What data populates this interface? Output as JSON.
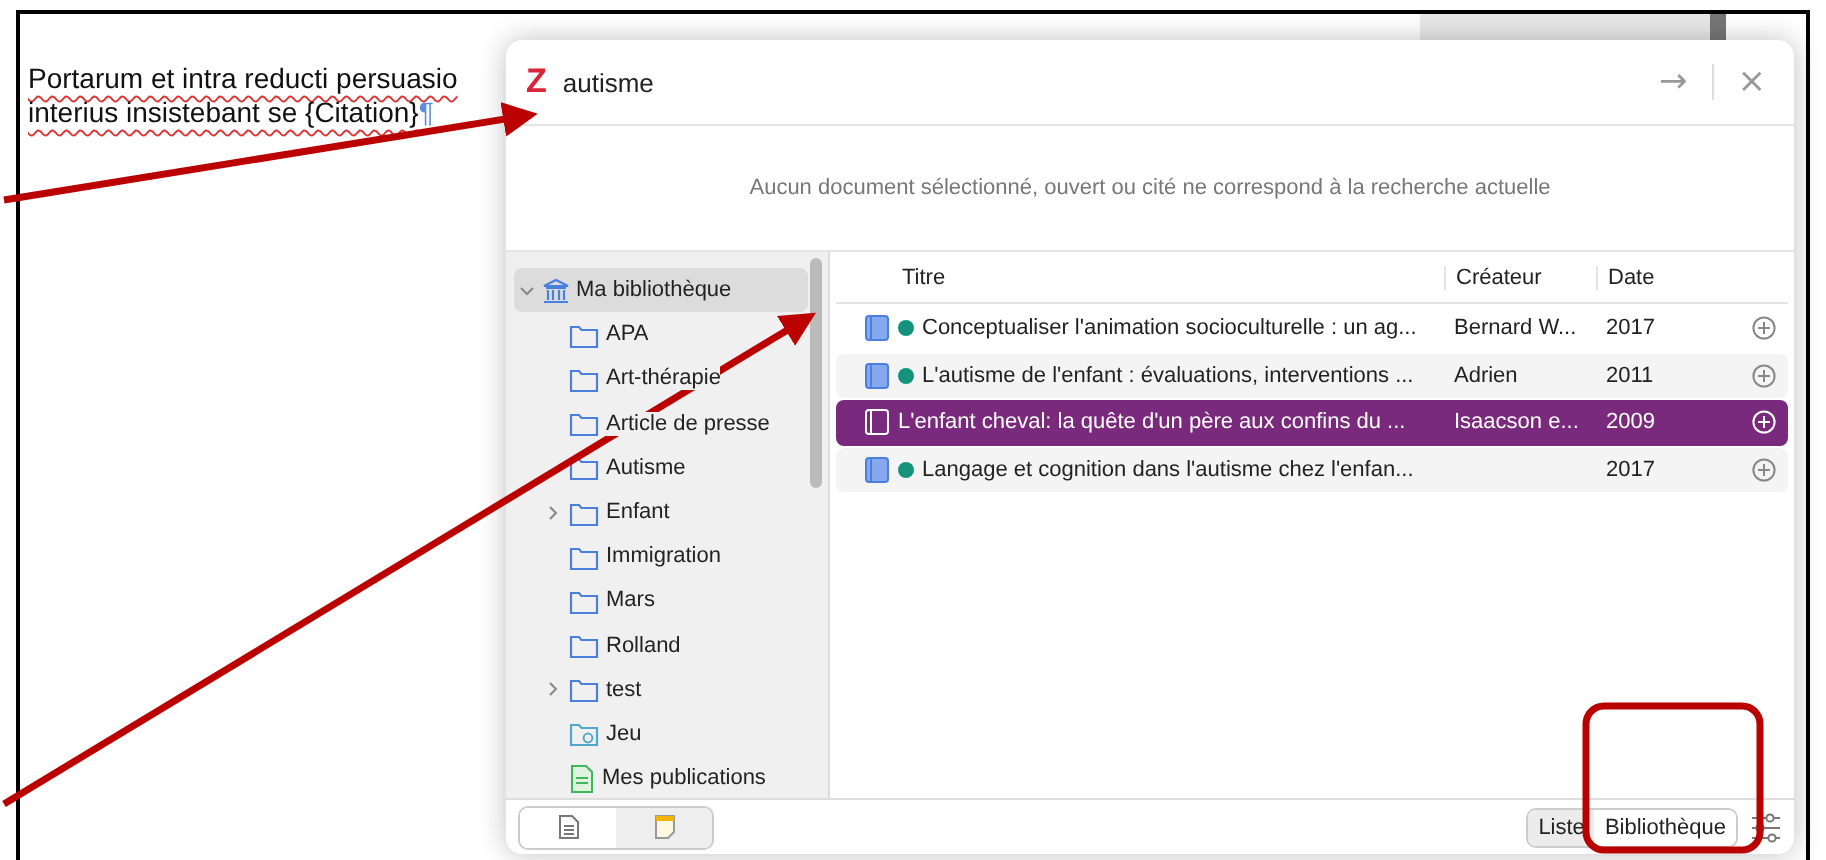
{
  "document": {
    "lines": [
      "Portarum et intra reducti persuasio",
      "interius insistebant se {Citation}"
    ],
    "paragraph_mark": "¶"
  },
  "dialog": {
    "logo": "Z",
    "search": {
      "value": "autisme"
    },
    "go": "→",
    "close": "×",
    "message": "Aucun document sélectionné, ouvert ou cité ne correspond à la recherche actuelle",
    "sidebar": {
      "items": [
        {
          "label": "Ma bibliothèque",
          "kind": "library",
          "selected": true,
          "expanded": true,
          "children": [
            {
              "label": "APA",
              "kind": "collection",
              "selected": false
            },
            {
              "label": "Art-thérapie",
              "kind": "collection",
              "selected": false
            },
            {
              "label": "Article de presse",
              "kind": "collection",
              "selected": false
            },
            {
              "label": "Autisme",
              "kind": "collection",
              "selected": false
            },
            {
              "label": "Enfant",
              "kind": "collection",
              "selected": false,
              "expanded": false
            },
            {
              "label": "Immigration",
              "kind": "collection",
              "selected": false
            },
            {
              "label": "Mars",
              "kind": "collection",
              "selected": false
            },
            {
              "label": "Rolland",
              "kind": "collection",
              "selected": false
            },
            {
              "label": "test",
              "kind": "collection",
              "selected": false,
              "expanded": false
            },
            {
              "label": "Jeu",
              "kind": "search",
              "selected": false
            },
            {
              "label": "Mes publications",
              "kind": "publications",
              "selected": false
            }
          ]
        }
      ]
    },
    "table": {
      "columns": [
        "Titre",
        "Créateur",
        "Date"
      ],
      "rows": [
        {
          "title": "Conceptualiser l'animation socioculturelle : un ag...",
          "creator": "Bernard W...",
          "date": "2017",
          "color": "#12937a",
          "selected": false
        },
        {
          "title": "L'autisme de l'enfant : évaluations, interventions ...",
          "creator": "Adrien",
          "date": "2011",
          "color": "#12937a",
          "selected": false
        },
        {
          "title": "L'enfant cheval: la quête d'un père aux confins du ...",
          "creator": "Isaacson e...",
          "date": "2009",
          "selected": true
        },
        {
          "title": "Langage et cognition dans l'autisme chez l'enfan...",
          "creator": "",
          "date": "2017",
          "color": "#12937a",
          "selected": false
        }
      ]
    },
    "view_tabs": [
      {
        "kind": "document",
        "selected": true
      },
      {
        "kind": "note",
        "selected": false
      }
    ],
    "mode_buttons": [
      {
        "label": "Liste",
        "selected": false
      },
      {
        "label": "Bibliothèque",
        "selected": true
      }
    ]
  }
}
